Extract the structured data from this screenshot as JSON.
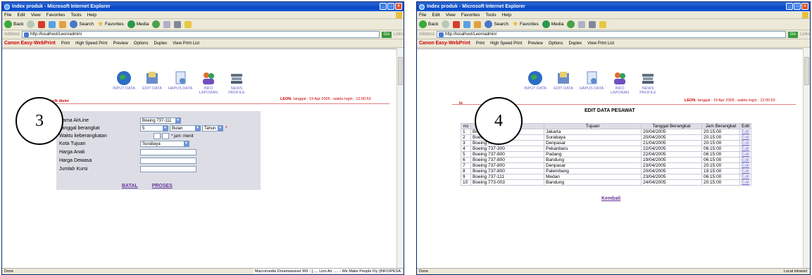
{
  "window1": {
    "title": "Index produk - Microsoft Internet Explorer",
    "menu": [
      "File",
      "Edit",
      "View",
      "Favorites",
      "Tools",
      "Help"
    ],
    "toolbar": {
      "back": "Back",
      "search": "Search",
      "favorites": "Favorites",
      "media": "Media"
    },
    "address_label": "Address",
    "url": "http://localhost/Leon/admin/",
    "go": "Go",
    "links": "Links",
    "canon": {
      "brand": "Canon",
      "app": "Easy-WebPrint",
      "print": "Print",
      "hsprint": "High Speed Print",
      "preview": "Preview",
      "options": "Options",
      "duplex": "Duplex",
      "viewlist": "View Print List"
    },
    "nav": [
      {
        "label": "INPUT DATA",
        "icon": "globe-icon"
      },
      {
        "label": "EDIT DATA",
        "icon": "folder-icon"
      },
      {
        "label": "HAPUS DATA",
        "icon": "document-icon"
      },
      {
        "label": "INFO LAPORAN",
        "icon": "people-icon"
      },
      {
        "label": "NEWS PROFILE",
        "icon": "books-icon"
      }
    ],
    "user_left": "logOut clk disini",
    "user_right_name": "LEON",
    "user_right_text": ", tanggal : 19 Apr 2005 , waktu login : 12:00:53",
    "form": {
      "airline_label": "Nama AirLine",
      "airline_value": "Boeing 737-111",
      "date_label": "Tanggal berangkat",
      "day_value": "5",
      "month_value": "Bulan",
      "year_value": "Tahun",
      "req": "*",
      "time_label": "Waktu keberangkatan",
      "time_sep": ":",
      "time_hint": "* jam: menit",
      "city_label": "Kota Tujuan",
      "city_value": "Surabaya",
      "child_label": "Harga Anak",
      "adult_label": "Harga Dewasa",
      "seats_label": "Jumlah Kursi",
      "cancel": "BATAL",
      "submit": "PROSES"
    },
    "circle": "3",
    "status_left": "Done",
    "status_right": "Macromedia Dreamweaver MX - [..... Lion Air ..... - We Make People Fly (INFO/PESA"
  },
  "window2": {
    "title": "Index produk - Microsoft Internet Explorer",
    "menu": [
      "File",
      "Edit",
      "View",
      "Favorites",
      "Tools",
      "Help"
    ],
    "toolbar": {
      "back": "Back",
      "search": "Search",
      "favorites": "Favorites",
      "media": "Media"
    },
    "address_label": "Address",
    "url": "http://localhost/Leon/admin/",
    "go": "Go",
    "links": "Links",
    "canon": {
      "brand": "Canon",
      "app": "Easy-WebPrint",
      "print": "Print",
      "hsprint": "High Speed Print",
      "preview": "Preview",
      "options": "Options",
      "duplex": "Duplex",
      "viewlist": "View Print List"
    },
    "nav": [
      {
        "label": "INPUT DATA",
        "icon": "globe-icon"
      },
      {
        "label": "EDIT DATA",
        "icon": "folder-icon"
      },
      {
        "label": "HAPUS DATA",
        "icon": "document-icon"
      },
      {
        "label": "INFO LAPORAN",
        "icon": "people-icon"
      },
      {
        "label": "NEWS PROFILE",
        "icon": "books-icon"
      }
    ],
    "user_left": "lo",
    "user_right_name": "LEON",
    "user_right_text": ", tanggal : 19 Apr 2005 , waktu login : 12:00:53",
    "heading": "EDIT DATA PESAWAT",
    "headers": [
      "no",
      "Nama AirLine",
      "Tujuan",
      "Tanggal Berangkat",
      "Jam Berangkat",
      "Edit"
    ],
    "rows": [
      [
        "1",
        "Boeing 737-100",
        "Jakarta",
        "20/04/2005",
        "20:15:00",
        "Edit"
      ],
      [
        "2",
        "Boeing 737-100",
        "Surabaya",
        "20/04/2005",
        "20:15:00",
        "Edit"
      ],
      [
        "3",
        "Boeing 737-400",
        "Denpasar",
        "21/04/2005",
        "20:15:00",
        "Edit"
      ],
      [
        "4",
        "Boeing 737-300",
        "Pekanbaru",
        "22/04/2005",
        "06:15:00",
        "Edit"
      ],
      [
        "5",
        "Boeing 737-800",
        "Padang",
        "22/04/2005",
        "06:15:00",
        "Edit"
      ],
      [
        "6",
        "Boeing 737-800",
        "Bandung",
        "19/04/2005",
        "06:15:00",
        "Edit"
      ],
      [
        "7",
        "Boeing 737-800",
        "Denpasar",
        "23/04/2005",
        "20:15:00",
        "Edit"
      ],
      [
        "8",
        "Boeing 737-800",
        "Palembang",
        "20/04/2005",
        "19:15:00",
        "Edit"
      ],
      [
        "9",
        "Boeing 737-111",
        "Medan",
        "23/04/2005",
        "06:15:00",
        "Edit"
      ],
      [
        "10",
        "Boeing 773-003",
        "Bandung",
        "24/04/2005",
        "20:15:00",
        "Edit"
      ]
    ],
    "back": "Kembali",
    "circle": "4",
    "status_left": "Done",
    "status_right": "Local intranet"
  }
}
